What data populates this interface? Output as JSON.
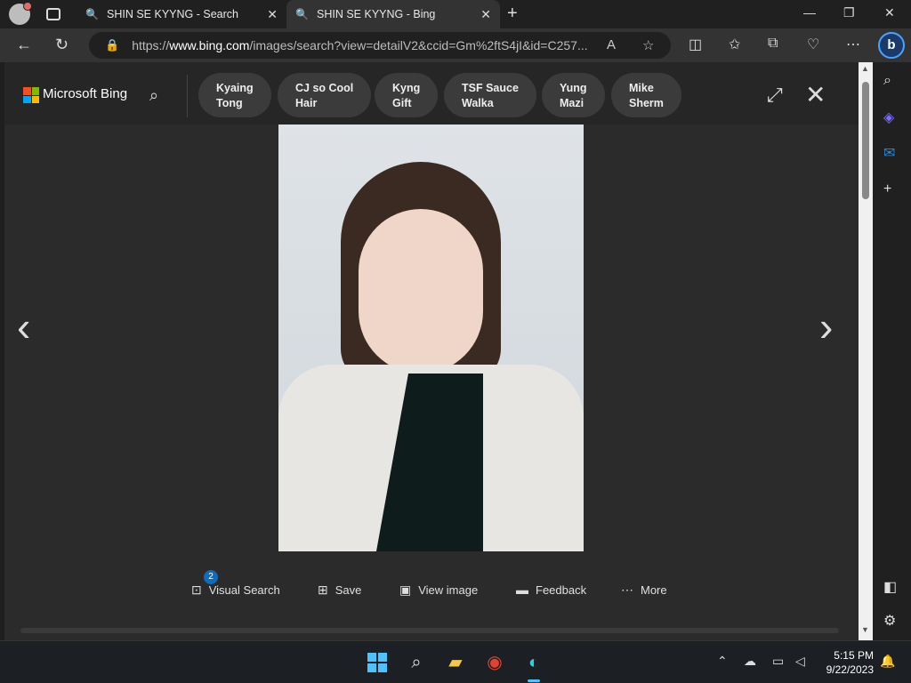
{
  "browser": {
    "tabs": [
      {
        "title": "SHIN SE KYYNG - Search",
        "active": false
      },
      {
        "title": "SHIN SE KYYNG - Bing",
        "active": true
      }
    ],
    "url_prefix": "https://",
    "url_domain": "www.bing.com",
    "url_path": "/images/search?view=detailV2&ccid=Gm%2ftS4jI&id=C257..."
  },
  "bing": {
    "brand": "Microsoft Bing",
    "related_searches": [
      {
        "line1": "Kyaing",
        "line2": "Tong"
      },
      {
        "line1": "CJ so Cool",
        "line2": "Hair"
      },
      {
        "line1": "Kyng",
        "line2": "Gift"
      },
      {
        "line1": "TSF Sauce",
        "line2": "Walka"
      },
      {
        "line1": "Yung",
        "line2": "Mazi"
      },
      {
        "line1": "Mike",
        "line2": "Sherm"
      }
    ],
    "actions": {
      "visual_search": "Visual Search",
      "visual_search_badge": "2",
      "save": "Save",
      "view_image": "View image",
      "feedback": "Feedback",
      "more": "More"
    }
  },
  "taskbar": {
    "time": "5:15 PM",
    "date": "9/22/2023"
  },
  "colors": {
    "accent": "#4cc2ff",
    "ms_red": "#f25022",
    "ms_green": "#7fba00",
    "ms_blue": "#00a4ef",
    "ms_yellow": "#ffb900"
  }
}
